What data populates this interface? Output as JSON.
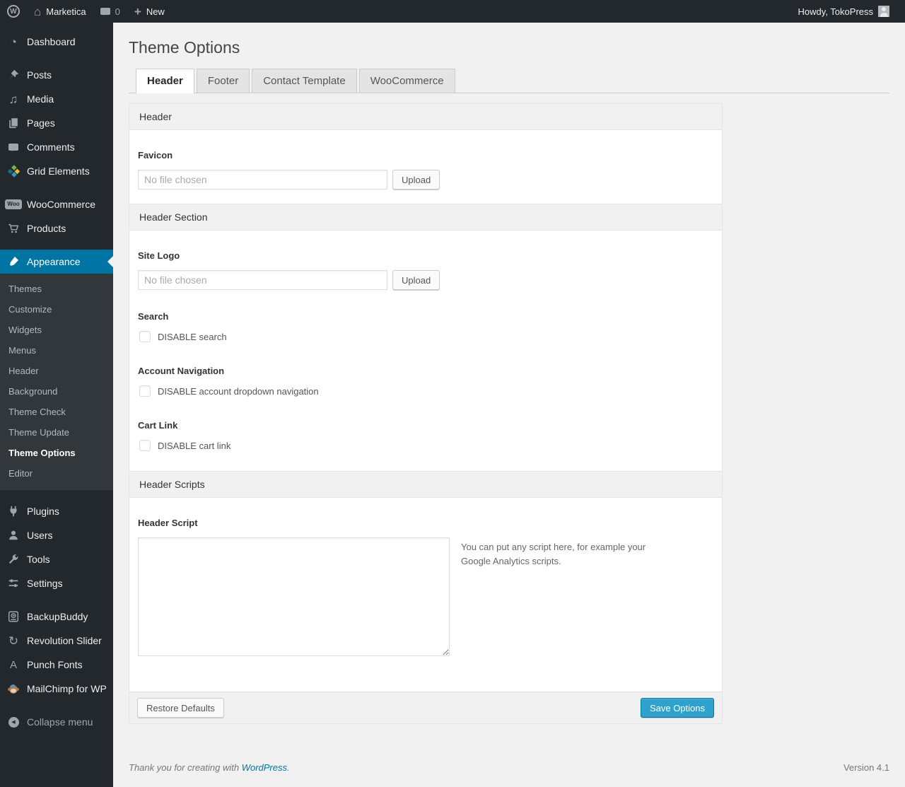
{
  "admin_bar": {
    "site_name": "Marketica",
    "comment_count": "0",
    "new_label": "New",
    "howdy_label": "Howdy, TokoPress"
  },
  "icons": {
    "wp_logo": "W",
    "home": "⌂",
    "plus": "+",
    "dashboard": "◔",
    "media": "♫",
    "revolution": "↻",
    "punch_fonts": "A",
    "collapse": "◀",
    "woo_label": "Woo"
  },
  "sidebar": {
    "items": [
      {
        "label": "Dashboard"
      },
      {
        "label": "Posts"
      },
      {
        "label": "Media"
      },
      {
        "label": "Pages"
      },
      {
        "label": "Comments"
      },
      {
        "label": "Grid Elements"
      },
      {
        "label": "WooCommerce"
      },
      {
        "label": "Products"
      },
      {
        "label": "Appearance"
      },
      {
        "label": "Plugins"
      },
      {
        "label": "Users"
      },
      {
        "label": "Tools"
      },
      {
        "label": "Settings"
      },
      {
        "label": "BackupBuddy"
      },
      {
        "label": "Revolution Slider"
      },
      {
        "label": "Punch Fonts"
      },
      {
        "label": "MailChimp for WP"
      },
      {
        "label": "Collapse menu"
      }
    ],
    "appearance_submenu": [
      "Themes",
      "Customize",
      "Widgets",
      "Menus",
      "Header",
      "Background",
      "Theme Check",
      "Theme Update",
      "Theme Options",
      "Editor"
    ]
  },
  "page": {
    "title": "Theme Options",
    "tabs": [
      "Header",
      "Footer",
      "Contact Template",
      "WooCommerce"
    ]
  },
  "panel": {
    "sections": [
      {
        "title": "Header"
      },
      {
        "title": "Header Section"
      },
      {
        "title": "Header Scripts"
      }
    ],
    "favicon": {
      "label": "Favicon",
      "placeholder": "No file chosen",
      "upload_label": "Upload"
    },
    "site_logo": {
      "label": "Site Logo",
      "placeholder": "No file chosen",
      "upload_label": "Upload"
    },
    "search": {
      "label": "Search",
      "checkbox_label": "DISABLE search"
    },
    "account_nav": {
      "label": "Account Navigation",
      "checkbox_label": "DISABLE account dropdown navigation"
    },
    "cart_link": {
      "label": "Cart Link",
      "checkbox_label": "DISABLE cart link"
    },
    "header_script": {
      "label": "Header Script",
      "value": "",
      "help": "You can put any script here, for example your Google Analytics scripts."
    },
    "footer": {
      "restore_label": "Restore Defaults",
      "save_label": "Save Options"
    }
  },
  "page_footer": {
    "thanks_prefix": "Thank you for creating with ",
    "thanks_link": "WordPress",
    "thanks_suffix": ".",
    "version": "Version 4.1"
  },
  "colors": {
    "admin_dark": "#23282d",
    "submenu_dark": "#32373c",
    "accent_blue": "#0074a2",
    "primary_button_blue": "#2ea2cc",
    "page_background": "#f1f1f1"
  }
}
